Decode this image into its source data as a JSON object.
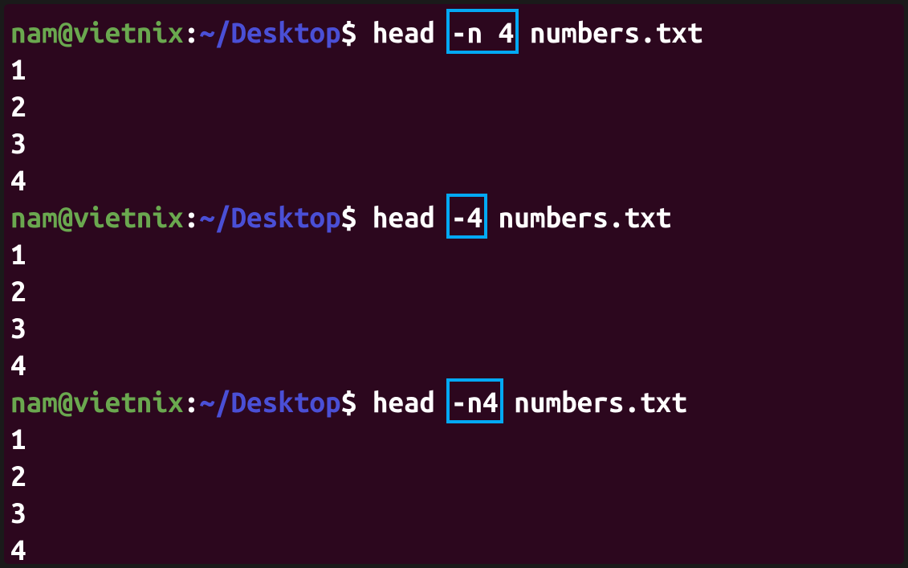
{
  "entries": [
    {
      "prompt": {
        "user": "nam@vietnix",
        "colon": ":",
        "path": "~/Desktop",
        "dollar": "$"
      },
      "cmd_pre": "head ",
      "boxed": "-n 4",
      "cmd_post": " numbers.txt",
      "output": [
        "1",
        "2",
        "3",
        "4"
      ]
    },
    {
      "prompt": {
        "user": "nam@vietnix",
        "colon": ":",
        "path": "~/Desktop",
        "dollar": "$"
      },
      "cmd_pre": "head ",
      "boxed": "-4",
      "cmd_post": " numbers.txt",
      "output": [
        "1",
        "2",
        "3",
        "4"
      ]
    },
    {
      "prompt": {
        "user": "nam@vietnix",
        "colon": ":",
        "path": "~/Desktop",
        "dollar": "$"
      },
      "cmd_pre": "head ",
      "boxed": "-n4",
      "cmd_post": " numbers.txt",
      "output": [
        "1",
        "2",
        "3",
        "4"
      ]
    }
  ]
}
